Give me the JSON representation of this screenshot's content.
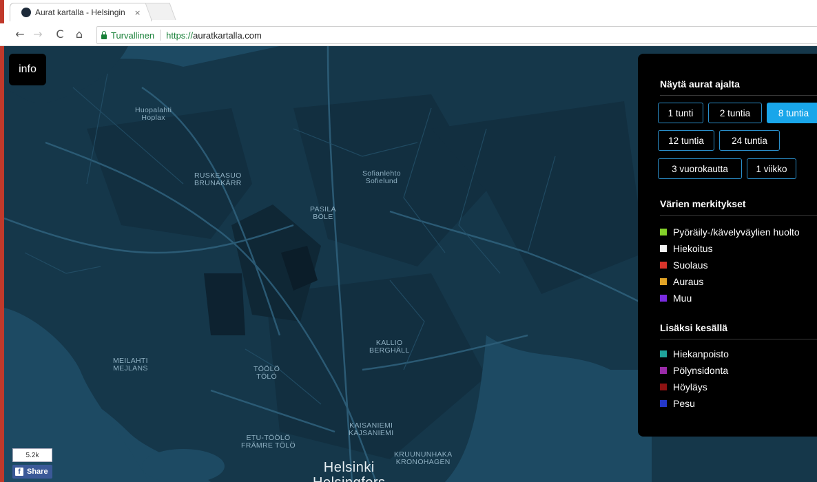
{
  "browser": {
    "tab_title": "Aurat kartalla - Helsingin",
    "tab_close": "×",
    "secure_label": "Turvallinen",
    "url_scheme": "https://",
    "url_host": "auratkartalla.com"
  },
  "map": {
    "info_label": "info",
    "places": {
      "huopalahti": "Huopalahti",
      "hoplax": "Hoplax",
      "ruskeasuo": "RUSKEASUO",
      "brunakarr": "BRUNAKÄRR",
      "sofianlehto": "Sofianlehto",
      "sofielund": "Sofielund",
      "pasila": "PASILA",
      "bole": "BÖLE",
      "meilahti": "MEILAHTI",
      "mejlans": "MEJLANS",
      "toolo": "TÖÖLÖ",
      "tolo": "TÖLÖ",
      "kallio": "KALLIO",
      "berghall": "BERGHÄLL",
      "etu_toolo": "ETU-TÖÖLÖ",
      "framre_tolo": "FRÄMRE TÖLÖ",
      "kaisaniemi": "KAISANIEMI",
      "kajsaniemi": "KAJSANIEMI",
      "kruununhaka": "KRUUNUNHAKA",
      "kronohagen": "KRONOHAGEN",
      "helsinki": "Helsinki",
      "helsingfors": "Helsingfors"
    }
  },
  "panel": {
    "time_heading": "Näytä aurat ajalta",
    "time_buttons": [
      "1 tunti",
      "2 tuntia",
      "8 tuntia",
      "12 tuntia",
      "24 tuntia",
      "3 vuorokautta",
      "1 viikko"
    ],
    "active_time": "8 tuntia",
    "colors_heading": "Värien merkitykset",
    "colors": [
      {
        "label": "Pyöräily-/kävelyväylien huolto",
        "color": "#84d12a"
      },
      {
        "label": "Hiekoitus",
        "color": "#f2f2f2"
      },
      {
        "label": "Suolaus",
        "color": "#d9342b"
      },
      {
        "label": "Auraus",
        "color": "#e0a326"
      },
      {
        "label": "Muu",
        "color": "#7a2be0"
      }
    ],
    "summer_heading": "Lisäksi kesällä",
    "summer_colors": [
      {
        "label": "Hiekanpoisto",
        "color": "#1fa39a"
      },
      {
        "label": "Pölynsidonta",
        "color": "#9a2ba8"
      },
      {
        "label": "Höyläys",
        "color": "#8e1212"
      },
      {
        "label": "Pesu",
        "color": "#2437c9"
      }
    ]
  },
  "share": {
    "count": "5.2k",
    "label": "Share"
  }
}
